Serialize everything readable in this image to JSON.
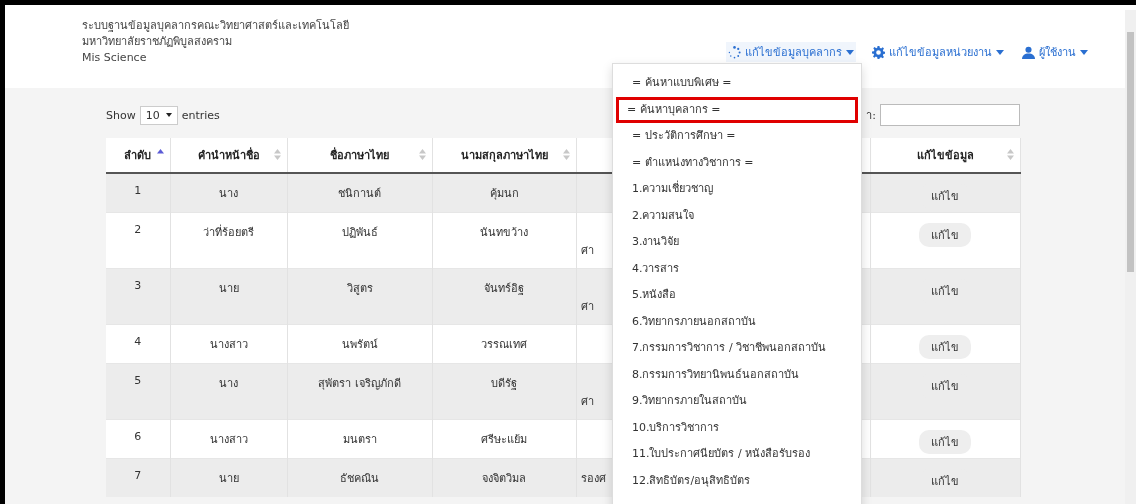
{
  "header": {
    "title_lines": [
      "ระบบฐานข้อมูลบุคลากรคณะวิทยาศาสตร์และเทคโนโลยี",
      "มหาวิทยาลัยราชภัฏพิบูลสงคราม",
      "Mis Science"
    ],
    "nav": [
      {
        "label": "แก้ไขข้อมูลบุคลากร",
        "expanded": true
      },
      {
        "label": "แก้ไขข้อมูลหน่วยงาน",
        "expanded": false
      },
      {
        "label": "ผู้ใช้งาน",
        "expanded": false
      }
    ]
  },
  "length": {
    "prefix": "Show",
    "value": "10",
    "suffix": "entries"
  },
  "search": {
    "label": "า:"
  },
  "table": {
    "columns": [
      {
        "label": "ลำดับ",
        "sorted": true
      },
      {
        "label": "คำนำหน้าชื่อ",
        "sorted": false
      },
      {
        "label": "ชื่อภาษาไทย",
        "sorted": false
      },
      {
        "label": "นามสกุลภาษาไทย",
        "sorted": false
      },
      {
        "label": "แก้ไขข้อมูล",
        "sorted": false
      }
    ],
    "rows": [
      {
        "cells": [
          "1",
          "นาง",
          "ชนิกานต์",
          "คุ้มนก",
          ""
        ],
        "tall": false,
        "action": "แก้ไข"
      },
      {
        "cells": [
          "2",
          "ว่าที่ร้อยตรี",
          "ปฏิพันธ์",
          "นันทขว้าง",
          "ศา"
        ],
        "tall": true,
        "action": "แก้ไข"
      },
      {
        "cells": [
          "3",
          "นาย",
          "วิสูตร",
          "จันทร์อิฐ",
          "ศา"
        ],
        "tall": true,
        "action": "แก้ไข"
      },
      {
        "cells": [
          "4",
          "นางสาว",
          "นพรัตน์",
          "วรรณเทศ",
          ""
        ],
        "tall": false,
        "action": "แก้ไข"
      },
      {
        "cells": [
          "5",
          "นาง",
          "สุพัตรา เจริญภักดี",
          "บดีรัฐ",
          "ศา"
        ],
        "tall": true,
        "action": "แก้ไข"
      },
      {
        "cells": [
          "6",
          "นางสาว",
          "มนตรา",
          "ศรีษะแย้ม",
          ""
        ],
        "tall": false,
        "action": "แก้ไข"
      },
      {
        "cells": [
          "7",
          "นาย",
          "ธัชคณิน",
          "จงจิตวิมล",
          "รองศ"
        ],
        "tall": false,
        "action": "แก้ไข"
      }
    ]
  },
  "dropdown": {
    "items": [
      {
        "label": "= ค้นหาแบบพิเศษ =",
        "highlighted": false
      },
      {
        "label": "= ค้นหาบุคลากร =",
        "highlighted": true
      },
      {
        "label": "= ประวัติการศึกษา =",
        "highlighted": false
      },
      {
        "label": "= ตำแหน่งทางวิชาการ =",
        "highlighted": false
      },
      {
        "label": "1.ความเชี่ยวชาญ",
        "highlighted": false
      },
      {
        "label": "2.ความสนใจ",
        "highlighted": false
      },
      {
        "label": "3.งานวิจัย",
        "highlighted": false
      },
      {
        "label": "4.วารสาร",
        "highlighted": false
      },
      {
        "label": "5.หนังสือ",
        "highlighted": false
      },
      {
        "label": "6.วิทยากรภายนอกสถาบัน",
        "highlighted": false
      },
      {
        "label": "7.กรรมการวิชาการ / วิชาชีพนอกสถาบัน",
        "highlighted": false
      },
      {
        "label": "8.กรรมการวิทยานิพนธ์นอกสถาบัน",
        "highlighted": false
      },
      {
        "label": "9.วิทยากรภายในสถาบัน",
        "highlighted": false
      },
      {
        "label": "10.บริการวิชาการ",
        "highlighted": false
      },
      {
        "label": "11.ใบประกาศนียบัตร / หนังสือรับรอง",
        "highlighted": false
      },
      {
        "label": "12.สิทธิบัตร/อนุสิทธิบัตร",
        "highlighted": false
      }
    ]
  }
}
